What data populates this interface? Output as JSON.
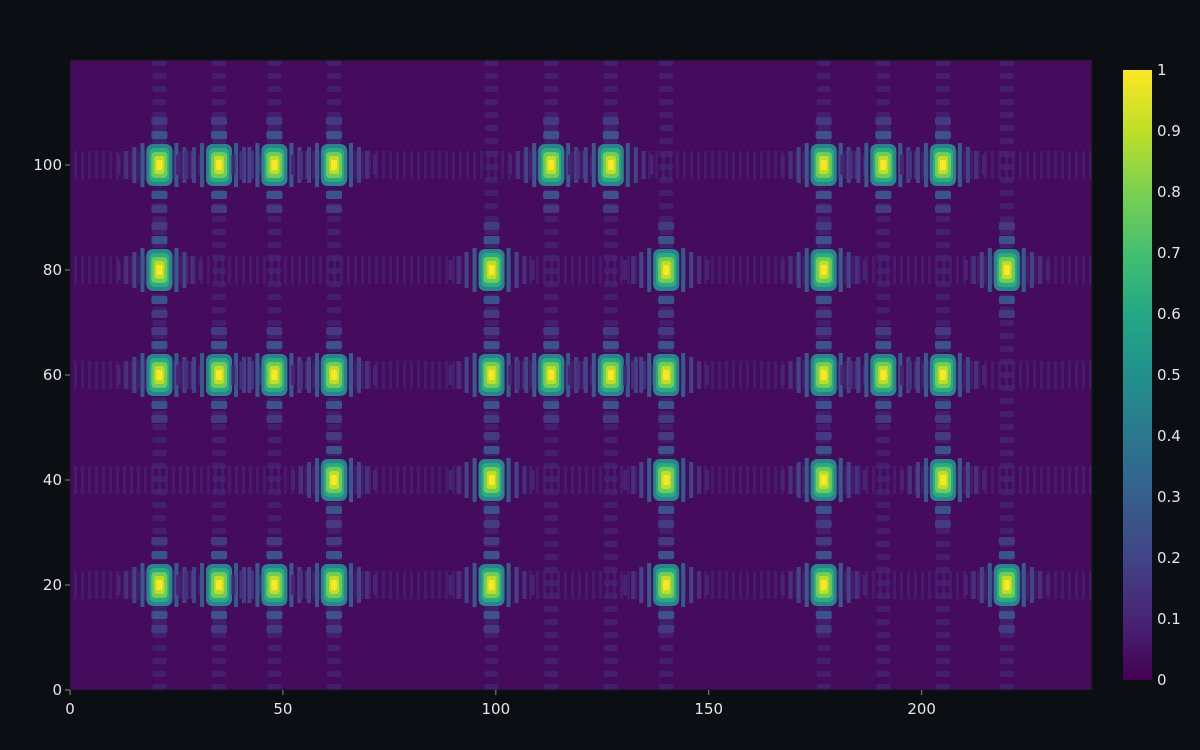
{
  "theme": {
    "background": "#0b0f14",
    "plot_edge": "#0f1a0f",
    "tick_text": "#e6e6e6",
    "colormap": "viridis"
  },
  "chart_data": {
    "type": "heatmap",
    "title": "",
    "xlabel": "",
    "ylabel": "",
    "xlim": [
      0,
      240
    ],
    "ylim": [
      0,
      120
    ],
    "x_ticks": [
      0,
      50,
      100,
      150,
      200
    ],
    "y_ticks": [
      0,
      20,
      40,
      60,
      80,
      100
    ],
    "colorbar": {
      "range": [
        0,
        1
      ],
      "ticks": [
        0,
        0.1,
        0.2,
        0.3,
        0.4,
        0.5,
        0.6,
        0.7,
        0.8,
        0.9,
        1
      ],
      "tick_labels": [
        "0",
        "0.1",
        "0.2",
        "0.3",
        "0.4",
        "0.5",
        "0.6",
        "0.7",
        "0.8",
        "0.9",
        "1"
      ]
    },
    "background_value": 0.03,
    "column_x": [
      21,
      35,
      48,
      62,
      99,
      113,
      127,
      140,
      177,
      191,
      205,
      220
    ],
    "row_y": [
      20,
      40,
      60,
      80,
      100
    ],
    "peaks": [
      {
        "x": 21,
        "y": 100,
        "value": 1.0
      },
      {
        "x": 35,
        "y": 100,
        "value": 1.0
      },
      {
        "x": 48,
        "y": 100,
        "value": 1.0
      },
      {
        "x": 62,
        "y": 100,
        "value": 1.0
      },
      {
        "x": 113,
        "y": 100,
        "value": 1.0
      },
      {
        "x": 127,
        "y": 100,
        "value": 1.0
      },
      {
        "x": 177,
        "y": 100,
        "value": 1.0
      },
      {
        "x": 191,
        "y": 100,
        "value": 1.0
      },
      {
        "x": 205,
        "y": 100,
        "value": 1.0
      },
      {
        "x": 21,
        "y": 80,
        "value": 1.0
      },
      {
        "x": 99,
        "y": 80,
        "value": 1.0
      },
      {
        "x": 140,
        "y": 80,
        "value": 1.0
      },
      {
        "x": 177,
        "y": 80,
        "value": 1.0
      },
      {
        "x": 220,
        "y": 80,
        "value": 1.0
      },
      {
        "x": 21,
        "y": 60,
        "value": 1.0
      },
      {
        "x": 35,
        "y": 60,
        "value": 1.0
      },
      {
        "x": 48,
        "y": 60,
        "value": 1.0
      },
      {
        "x": 62,
        "y": 60,
        "value": 1.0
      },
      {
        "x": 99,
        "y": 60,
        "value": 1.0
      },
      {
        "x": 113,
        "y": 60,
        "value": 1.0
      },
      {
        "x": 127,
        "y": 60,
        "value": 1.0
      },
      {
        "x": 140,
        "y": 60,
        "value": 1.0
      },
      {
        "x": 177,
        "y": 60,
        "value": 1.0
      },
      {
        "x": 191,
        "y": 60,
        "value": 1.0
      },
      {
        "x": 205,
        "y": 60,
        "value": 1.0
      },
      {
        "x": 62,
        "y": 40,
        "value": 1.0
      },
      {
        "x": 99,
        "y": 40,
        "value": 1.0
      },
      {
        "x": 140,
        "y": 40,
        "value": 1.0
      },
      {
        "x": 177,
        "y": 40,
        "value": 1.0
      },
      {
        "x": 205,
        "y": 40,
        "value": 1.0
      },
      {
        "x": 21,
        "y": 20,
        "value": 1.0
      },
      {
        "x": 35,
        "y": 20,
        "value": 1.0
      },
      {
        "x": 48,
        "y": 20,
        "value": 1.0
      },
      {
        "x": 62,
        "y": 20,
        "value": 1.0
      },
      {
        "x": 99,
        "y": 20,
        "value": 1.0
      },
      {
        "x": 140,
        "y": 20,
        "value": 1.0
      },
      {
        "x": 177,
        "y": 20,
        "value": 1.0
      },
      {
        "x": 220,
        "y": 20,
        "value": 1.0
      }
    ]
  }
}
